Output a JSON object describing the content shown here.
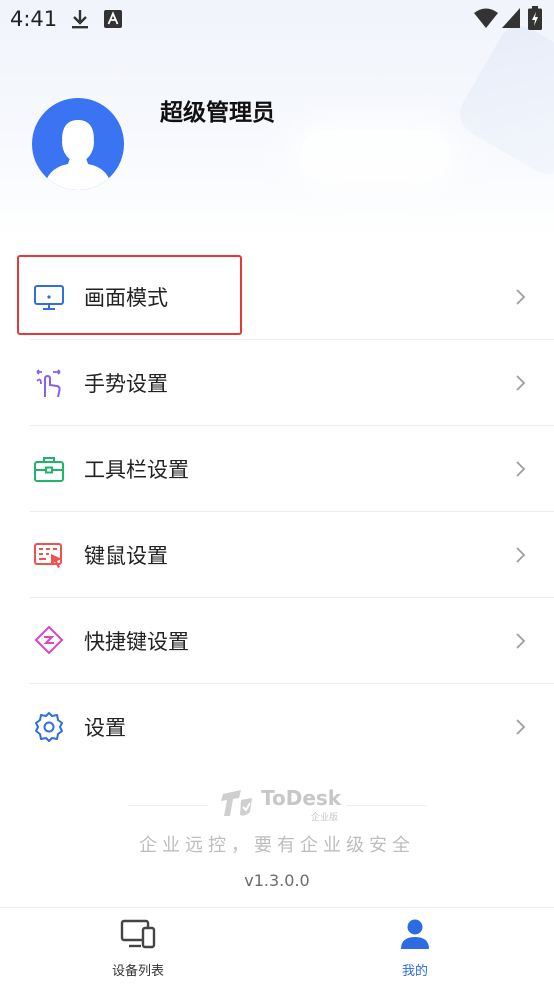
{
  "status_bar": {
    "time": "4:41",
    "icons": [
      "download-icon",
      "a-badge-icon",
      "wifi-icon",
      "signal-icon",
      "battery-charging-icon"
    ]
  },
  "profile": {
    "username": "超级管理员",
    "avatar_color": "#3a74f3"
  },
  "menu": {
    "items": [
      {
        "label": "画面模式",
        "icon": "monitor-icon",
        "color": "#2f6fe0",
        "highlighted": true
      },
      {
        "label": "手势设置",
        "icon": "gesture-hand-icon",
        "color": "#8a5cf0"
      },
      {
        "label": "工具栏设置",
        "icon": "toolbox-icon",
        "color": "#1fb56a"
      },
      {
        "label": "键鼠设置",
        "icon": "keyboard-mouse-icon",
        "color": "#ef5350"
      },
      {
        "label": "快捷键设置",
        "icon": "shortcut-diamond-icon",
        "color": "#d946c6"
      },
      {
        "label": "设置",
        "icon": "gear-icon",
        "color": "#2f6fe0"
      }
    ]
  },
  "footer": {
    "brand_name": "ToDesk",
    "brand_sub": "企业版",
    "slogan": "企业远控，要有企业级安全",
    "version": "v1.3.0.0"
  },
  "bottom_nav": {
    "tabs": [
      {
        "label": "设备列表",
        "icon": "devices-icon",
        "active": false
      },
      {
        "label": "我的",
        "icon": "user-icon",
        "active": true
      }
    ],
    "active_color": "#2d6be4"
  }
}
